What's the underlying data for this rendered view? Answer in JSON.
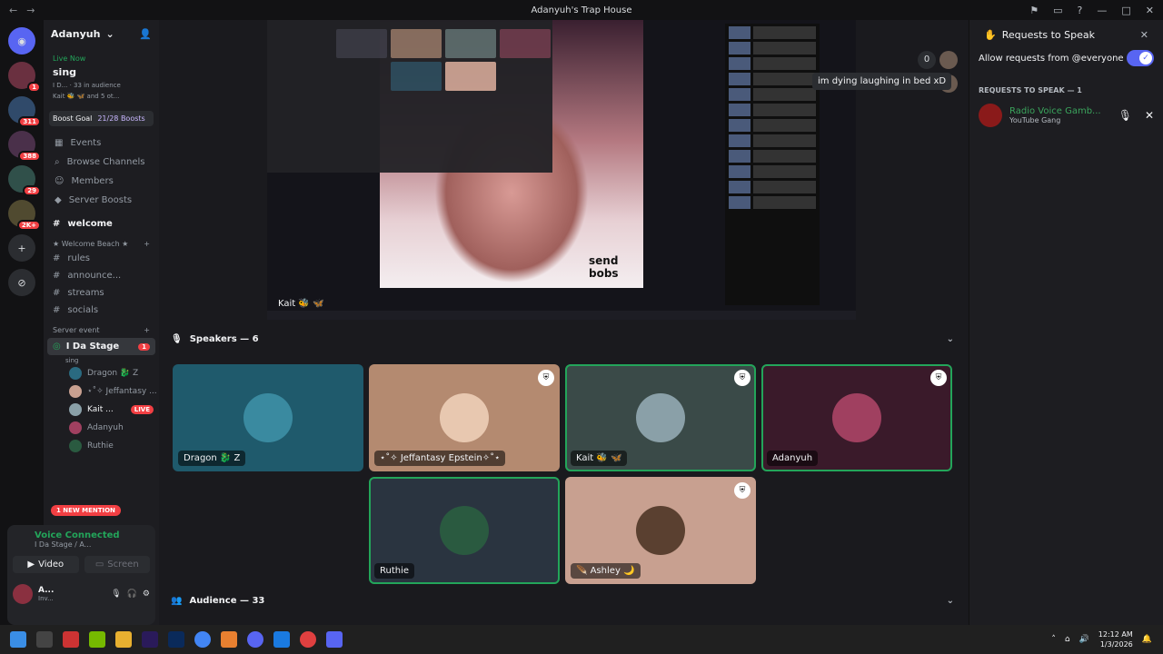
{
  "window": {
    "title": "Adanyuh's Trap House"
  },
  "server": {
    "name": "Adanyuh",
    "live_label": "Live Now",
    "stage_name": "sing",
    "stage_info": "I D... · 33 in audience",
    "stage_people": "Kait 🐝 🦋 and 5 ot...",
    "boost_label": "Boost Goal",
    "boost_count": "21/28 Boosts"
  },
  "menu": [
    {
      "icon": "calendar",
      "label": "Events"
    },
    {
      "icon": "search",
      "label": "Browse Channels"
    },
    {
      "icon": "people",
      "label": "Members"
    },
    {
      "icon": "boost",
      "label": "Server Boosts"
    }
  ],
  "welcome": "welcome",
  "category_welcome": "★ Welcome Beach ★",
  "channels": [
    {
      "label": "rules"
    },
    {
      "label": "announce..."
    },
    {
      "label": "streams"
    },
    {
      "label": "socials"
    }
  ],
  "category_event": "Server event",
  "stage_channel": {
    "label": "I Da Stage",
    "badge": "1",
    "sub": "sing"
  },
  "voice_users": [
    {
      "name": "Dragon 🐉 Z",
      "live": ""
    },
    {
      "name": "⋆˚✧ Jeffantasy ...",
      "live": ""
    },
    {
      "name": "Kait ...",
      "live": "LIVE"
    },
    {
      "name": "Adanyuh",
      "live": ""
    },
    {
      "name": "Ruthie",
      "live": ""
    }
  ],
  "mention_pill": "1 NEW MENTION",
  "voice_panel": {
    "status": "Voice Connected",
    "location": "I Da Stage / A...",
    "video": "Video",
    "screen": "Screen",
    "user": "A...",
    "user_sub": "Inv..."
  },
  "screen_share": {
    "caption_line1": "send",
    "caption_line2": "bobs",
    "streamer": "Kait 🐝 🦋"
  },
  "viewer_count": "0",
  "tooltip": "im dying laughing in bed xD",
  "speakers_label": "Speakers — 6",
  "speakers": [
    {
      "name": "Dragon 🐉 Z",
      "bg": "#1f5a6c",
      "pic": "#3a8aa0",
      "shield": false,
      "speaking": false
    },
    {
      "name": "⋆˚✧ Jeffantasy Epstein✧˚⋆",
      "bg": "#b48a70",
      "pic": "#e8c8b0",
      "shield": true,
      "speaking": false
    },
    {
      "name": "Kait 🐝 🦋",
      "bg": "#3a4a48",
      "pic": "#8aa0a8",
      "shield": true,
      "speaking": true
    },
    {
      "name": "Adanyuh",
      "bg": "#3a1a2a",
      "pic": "#a04060",
      "shield": true,
      "speaking": true
    },
    {
      "name": "Ruthie",
      "bg": "#2a3440",
      "pic": "#2a5a40",
      "shield": false,
      "speaking": true
    },
    {
      "name": "🪶 Ashley 🌙",
      "bg": "#c8a090",
      "pic": "#5a4030",
      "shield": true,
      "speaking": false
    }
  ],
  "audience_label": "Audience — 33",
  "requests": {
    "title": "Requests to Speak",
    "allow_label": "Allow requests from @everyone",
    "section": "REQUESTS TO SPEAK — 1",
    "user_name": "Radio Voice Gamb...",
    "user_sub": "YouTube Gang"
  },
  "taskbar": {
    "time": "12:12 AM",
    "date": "1/3/2026",
    "discord_badge": "1"
  }
}
